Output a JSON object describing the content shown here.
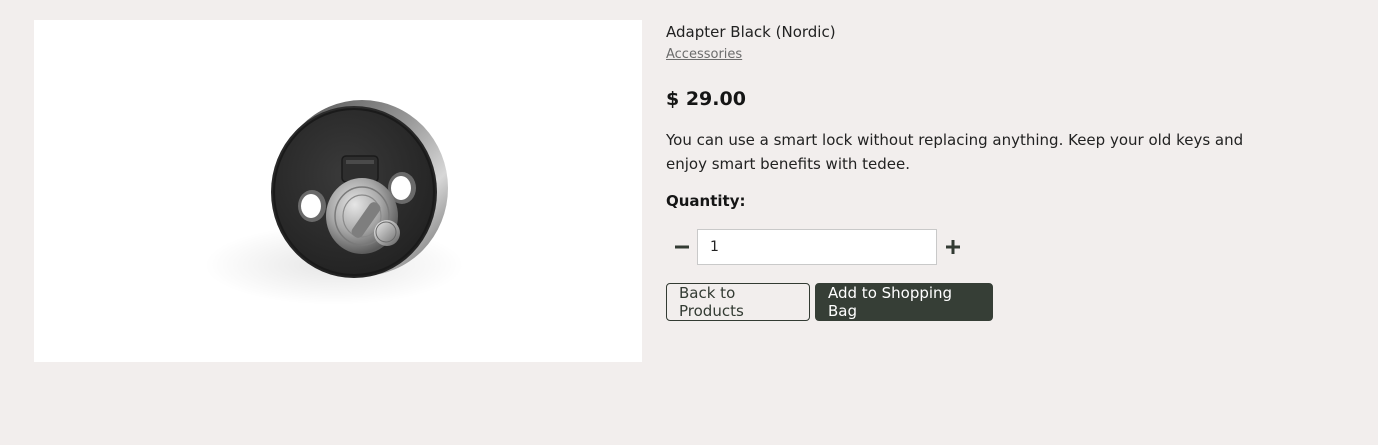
{
  "product": {
    "image_alt": "Adapter Black (Nordic)",
    "title": "Adapter Black (Nordic)",
    "category": "Accessories",
    "price": "$ 29.00",
    "description": "You can use a smart lock without replacing anything. Keep your old keys and enjoy smart benefits with tedee."
  },
  "quantity": {
    "label": "Quantity:",
    "value": "1",
    "decrement_icon": "minus-icon",
    "increment_icon": "plus-icon"
  },
  "actions": {
    "back_label": "Back to Products",
    "add_label": "Add to Shopping Bag"
  },
  "colors": {
    "background": "#f2eeed",
    "primary_button": "#363e36",
    "link": "#6c6c6c"
  }
}
